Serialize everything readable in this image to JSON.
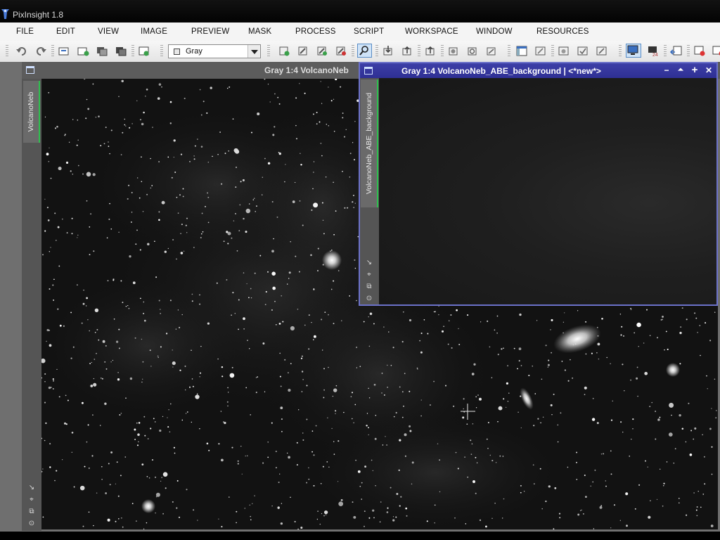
{
  "app": {
    "title": "PixInsight 1.8"
  },
  "menu": [
    "FILE",
    "EDIT",
    "VIEW",
    "IMAGE",
    "PREVIEW",
    "MASK",
    "PROCESS",
    "SCRIPT",
    "WORKSPACE",
    "WINDOW",
    "RESOURCES"
  ],
  "toolbar": {
    "colorspace_value": "Gray",
    "icons": [
      "undo-icon",
      "redo-icon",
      "new-image-icon",
      "duplicate-icon",
      "clone-icon",
      "fit-icon",
      "new-preview-icon",
      "zoom-in-icon",
      "zoom-out-icon",
      "zoom-fit-icon",
      "zoom-actual-icon",
      "readout-mode-icon",
      "stf-auto-icon",
      "stf-reset-icon",
      "mask-show-icon",
      "mask-invert-icon",
      "mask-enable-icon",
      "screen-icon",
      "grid-icon",
      "window-icon",
      "monitor-icon",
      "process-icon",
      "export-icon",
      "close-view-icon"
    ]
  },
  "main_window": {
    "title": "Gray 1:4 VolcanoNeb",
    "view_tab": "VolcanoNeb",
    "side_icons": [
      "↘",
      "⌖",
      "⧉",
      "⊙"
    ]
  },
  "float_window": {
    "title": "Gray 1:4 VolcanoNeb_ABE_background | <*new*>",
    "view_tab": "VolcanoNeb_ABE_background",
    "side_icons": [
      "↘",
      "⌖",
      "⧉",
      "⊙"
    ],
    "buttons": [
      "−",
      "⏶",
      "+",
      "✕"
    ]
  }
}
